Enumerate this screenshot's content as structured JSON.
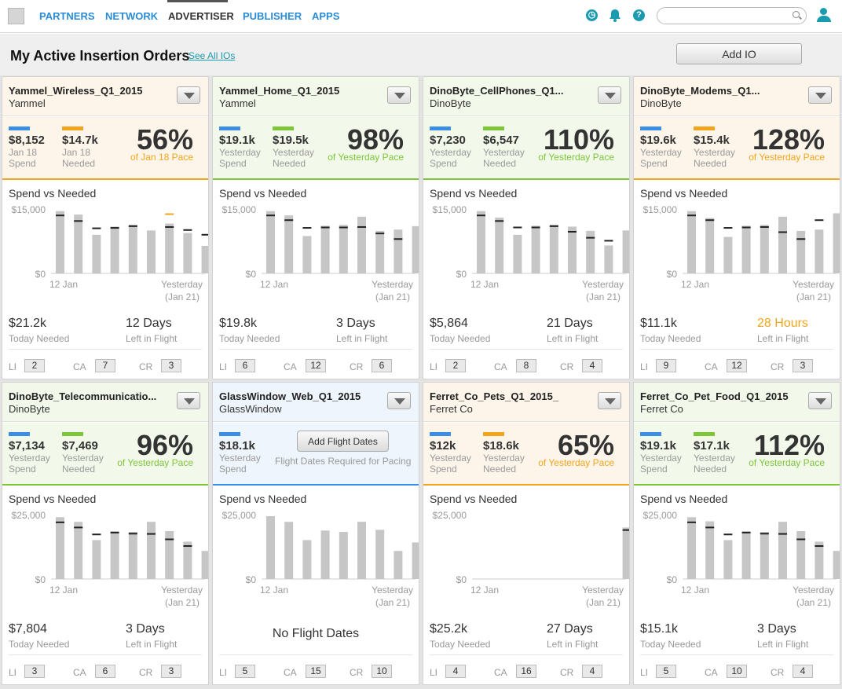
{
  "nav": {
    "items": [
      "PARTNERS",
      "NETWORK",
      "ADVERTISER",
      "PUBLISHER",
      "APPS"
    ],
    "active": "ADVERTISER",
    "search_placeholder": ""
  },
  "page": {
    "title": "My Active Insertion Orders",
    "see_all": "See All IOs",
    "add_io": "Add IO"
  },
  "colors": {
    "blue": "#3a8ee6",
    "orange": "#f2a51b",
    "green": "#7dc63a",
    "bar": "#c6c6c6",
    "needed_mark": "#222",
    "teal": "#1a9bb0"
  },
  "cards": [
    {
      "name": "Yammel_Wireless_Q1_2015",
      "advertiser": "Yammel",
      "theme": "orange",
      "spend": "$8,152",
      "spend_label1": "Jan 18",
      "spend_label2": "Spend",
      "needed": "$14.7k",
      "needed_label1": "Jan 18",
      "needed_label2": "Needed",
      "pct": "56%",
      "pct_label": "of Jan 18 Pace",
      "pct_color": "orange",
      "chart_title": "Spend vs Needed",
      "ymax_label": "$15,000",
      "ymin_label": "$0",
      "x_start": "12 Jan",
      "x_end1": "Yesterday",
      "x_end2": "(Jan 21)",
      "today_needed": "$21.2k",
      "today_needed_label": "Today Needed",
      "left": "12 Days",
      "left_label": "Left in Flight",
      "left_color": "normal",
      "li": "2",
      "ca": "7",
      "cr": "3",
      "highlight_index": 6,
      "ymax": 15000,
      "bars": [
        14500,
        13700,
        9000,
        10900,
        11300,
        10000,
        11600,
        9400,
        6400,
        8500
      ],
      "needed_marks": [
        13500,
        12200,
        10500,
        10600,
        11000,
        13800,
        10800,
        10100,
        9000,
        null
      ],
      "needed_colors": [
        null,
        null,
        null,
        null,
        null,
        "orange",
        null,
        null,
        null,
        null
      ],
      "mark_index_override": null
    },
    {
      "name": "Yammel_Home_Q1_2015",
      "advertiser": "Yammel",
      "theme": "green",
      "spend": "$19.1k",
      "spend_label1": "Yesterday",
      "spend_label2": "Spend",
      "needed": "$19.5k",
      "needed_label1": "Yesterday",
      "needed_label2": "Needed",
      "pct": "98%",
      "pct_label": "of Yesterday Pace",
      "pct_color": "green",
      "chart_title": "Spend vs Needed",
      "ymax_label": "$15,000",
      "ymin_label": "$0",
      "x_start": "12 Jan",
      "x_end1": "Yesterday",
      "x_end2": "(Jan 21)",
      "today_needed": "$19.8k",
      "today_needed_label": "Today Needed",
      "left": "3 Days",
      "left_label": "Left in Flight",
      "left_color": "normal",
      "li": "6",
      "ca": "12",
      "cr": "6",
      "highlight_index": 10,
      "ymax": 15000,
      "bars": [
        14500,
        13500,
        8700,
        11100,
        11300,
        13200,
        9900,
        10200,
        11000,
        10800
      ],
      "needed_marks": [
        13500,
        12400,
        10600,
        10700,
        10700,
        10800,
        9300,
        8000,
        11000,
        null
      ],
      "needed_colors": [
        null,
        null,
        null,
        null,
        null,
        null,
        null,
        null,
        "green",
        null
      ]
    },
    {
      "name": "DinoByte_CellPhones_Q1...",
      "advertiser": "DinoByte",
      "theme": "green",
      "spend": "$7,230",
      "spend_label1": "Yesterday",
      "spend_label2": "Spend",
      "needed": "$6,547",
      "needed_label1": "Yesterday",
      "needed_label2": "Needed",
      "pct": "110%",
      "pct_label": "of Yesterday Pace",
      "pct_color": "green",
      "chart_title": "Spend vs Needed",
      "ymax_label": "$15,000",
      "ymin_label": "$0",
      "x_start": "12 Jan",
      "x_end1": "Yesterday",
      "x_end2": "(Jan 21)",
      "today_needed": "$5,864",
      "today_needed_label": "Today Needed",
      "left": "21 Days",
      "left_label": "Left in Flight",
      "left_color": "normal",
      "li": "2",
      "ca": "8",
      "cr": "4",
      "highlight_index": 10,
      "ymax": 15000,
      "bars": [
        14500,
        13000,
        9000,
        11100,
        11300,
        10900,
        9900,
        6500,
        10000,
        9800
      ],
      "needed_marks": [
        13500,
        12200,
        10700,
        10700,
        11000,
        9700,
        8300,
        7600,
        10000,
        null
      ],
      "needed_colors": [
        null,
        null,
        null,
        null,
        null,
        null,
        null,
        null,
        "green",
        null
      ]
    },
    {
      "name": "DinoByte_Modems_Q1...",
      "advertiser": "DinoByte",
      "theme": "orange",
      "spend": "$19.6k",
      "spend_label1": "Yesterday",
      "spend_label2": "Spend",
      "needed": "$15.4k",
      "needed_label1": "Yesterday",
      "needed_label2": "Needed",
      "pct": "128%",
      "pct_label": "of Yesterday Pace",
      "pct_color": "orange",
      "chart_title": "Spend vs Needed",
      "ymax_label": "$15,000",
      "ymin_label": "$0",
      "x_start": "12 Jan",
      "x_end1": "Yesterday",
      "x_end2": "(Jan 21)",
      "today_needed": "$11.1k",
      "today_needed_label": "Today Needed",
      "left": "28 Hours",
      "left_label": "Left in Flight",
      "left_color": "orange",
      "li": "9",
      "ca": "12",
      "cr": "3",
      "highlight_index": 10,
      "ymax": 15000,
      "bars": [
        14500,
        12900,
        8500,
        11100,
        11300,
        13200,
        9900,
        10200,
        14000,
        10800
      ],
      "needed_marks": [
        13500,
        12400,
        10600,
        10700,
        10800,
        9600,
        8000,
        12400,
        11800,
        null
      ],
      "needed_colors": [
        null,
        null,
        null,
        null,
        null,
        null,
        null,
        null,
        "orange",
        null
      ]
    },
    {
      "name": "DinoByte_Telecommunicatio...",
      "advertiser": "DinoByte",
      "theme": "green",
      "spend": "$7,134",
      "spend_label1": "Yesterday",
      "spend_label2": "Spend",
      "needed": "$7,469",
      "needed_label1": "Yesterday",
      "needed_label2": "Needed",
      "pct": "96%",
      "pct_label": "of Yesterday Pace",
      "pct_color": "green",
      "chart_title": "Spend vs Needed",
      "ymax_label": "$25,000",
      "ymin_label": "$0",
      "x_start": "12 Jan",
      "x_end1": "Yesterday",
      "x_end2": "(Jan 21)",
      "today_needed": "$7,804",
      "today_needed_label": "Today Needed",
      "left": "3 Days",
      "left_label": "Left in Flight",
      "left_color": "normal",
      "li": "3",
      "ca": "6",
      "cr": "3",
      "highlight_index": 10,
      "ymax": 25000,
      "bars": [
        24000,
        22200,
        15100,
        18600,
        18300,
        22200,
        18600,
        14500,
        10900,
        14500
      ],
      "needed_marks": [
        22000,
        20000,
        17300,
        18000,
        17600,
        17500,
        15400,
        12800,
        15000,
        null
      ],
      "needed_colors": [
        null,
        null,
        null,
        null,
        null,
        null,
        null,
        null,
        "green",
        null
      ]
    },
    {
      "name": "GlassWindow_Web_Q1_2015",
      "advertiser": "GlassWindow",
      "theme": "blue",
      "spend": "$18.1k",
      "spend_label1": "Yesterday",
      "spend_label2": "Spend",
      "flight_btn": "Add Flight Dates",
      "flight_note": "Flight Dates Required for Pacing",
      "chart_title": "Spend vs Needed",
      "ymax_label": "$25,000",
      "ymin_label": "$0",
      "x_start": "12 Jan",
      "x_end1": "Yesterday",
      "x_end2": "(Jan 21)",
      "no_flight": "No Flight Dates",
      "li": "5",
      "ca": "15",
      "cr": "10",
      "highlight_index": 10,
      "ymax": 25000,
      "bars": [
        24400,
        22200,
        15100,
        18800,
        18300,
        22200,
        19100,
        10900,
        14200,
        14200
      ],
      "needed_marks": [
        null,
        null,
        null,
        null,
        null,
        null,
        null,
        null,
        null,
        null
      ],
      "needed_colors": []
    },
    {
      "name": "Ferret_Co_Pets_Q1_2015_",
      "advertiser": "Ferret Co",
      "theme": "orange",
      "spend": "$12k",
      "spend_label1": "Yesterday",
      "spend_label2": "Spend",
      "needed": "$18.6k",
      "needed_label1": "Yesterday",
      "needed_label2": "Needed",
      "pct": "65%",
      "pct_label": "of Yesterday Pace",
      "pct_color": "orange",
      "chart_title": "Spend vs Needed",
      "ymax_label": "$25,000",
      "ymin_label": "$0",
      "x_start": "12 Jan",
      "x_end1": "Yesterday",
      "x_end2": "(Jan 21)",
      "today_needed": "$25.2k",
      "today_needed_label": "Today Needed",
      "left": "27 Days",
      "left_label": "Left in Flight",
      "left_color": "normal",
      "li": "4",
      "ca": "16",
      "cr": "4",
      "highlight_index": 10,
      "ymax": 25000,
      "bars": [
        0,
        0,
        0,
        0,
        0,
        0,
        0,
        0,
        20000,
        10900
      ],
      "needed_marks": [
        null,
        null,
        null,
        null,
        null,
        null,
        null,
        null,
        null,
        null
      ],
      "needed_colors": []
    },
    {
      "name": "Ferret_Co_Pet_Food_Q1_2015",
      "advertiser": "Ferret Co",
      "theme": "green",
      "spend": "$19.1k",
      "spend_label1": "Yesterday",
      "spend_label2": "Spend",
      "needed": "$17.1k",
      "needed_label1": "Yesterday",
      "needed_label2": "Needed",
      "pct": "112%",
      "pct_label": "of Yesterday Pace",
      "pct_color": "green",
      "chart_title": "Spend vs Needed",
      "ymax_label": "$25,000",
      "ymin_label": "$0",
      "x_start": "12 Jan",
      "x_end1": "Yesterday",
      "x_end2": "(Jan 21)",
      "today_needed": "$15.1k",
      "today_needed_label": "Today Needed",
      "left": "3 Days",
      "left_label": "Left in Flight",
      "left_color": "normal",
      "li": "5",
      "ca": "10",
      "cr": "4",
      "highlight_index": 10,
      "ymax": 25000,
      "bars": [
        24000,
        22400,
        15100,
        18600,
        18300,
        22200,
        18600,
        14500,
        10900,
        14500
      ],
      "needed_marks": [
        22000,
        20000,
        17300,
        18000,
        17600,
        17500,
        15400,
        12800,
        15000,
        null
      ],
      "needed_colors": [
        null,
        null,
        null,
        null,
        null,
        null,
        null,
        null,
        "green",
        null
      ]
    }
  ],
  "footer_labels": {
    "li": "LI",
    "ca": "CA",
    "cr": "CR"
  },
  "chart_data": [
    {
      "type": "bar",
      "title": "Spend vs Needed",
      "categories": [
        "12 Jan",
        "",
        "",
        "",
        "",
        "",
        "",
        "",
        "",
        "Yesterday (Jan 21)"
      ],
      "series": [
        {
          "values": [
            14500,
            13700,
            9000,
            10900,
            11300,
            10000,
            11600,
            9400,
            6400,
            8500
          ]
        }
      ],
      "ylim": [
        0,
        15000
      ]
    },
    {
      "type": "bar",
      "title": "Spend vs Needed",
      "categories": [
        "12 Jan",
        "",
        "",
        "",
        "",
        "",
        "",
        "",
        "",
        "Yesterday (Jan 21)"
      ],
      "series": [
        {
          "values": [
            14500,
            13500,
            8700,
            11100,
            11300,
            13200,
            9900,
            10200,
            11000,
            10800
          ]
        }
      ],
      "ylim": [
        0,
        15000
      ]
    },
    {
      "type": "bar",
      "title": "Spend vs Needed",
      "categories": [
        "12 Jan",
        "",
        "",
        "",
        "",
        "",
        "",
        "",
        "",
        "Yesterday (Jan 21)"
      ],
      "series": [
        {
          "values": [
            14500,
            13000,
            9000,
            11100,
            11300,
            10900,
            9900,
            6500,
            10000,
            9800
          ]
        }
      ],
      "ylim": [
        0,
        15000
      ]
    },
    {
      "type": "bar",
      "title": "Spend vs Needed",
      "categories": [
        "12 Jan",
        "",
        "",
        "",
        "",
        "",
        "",
        "",
        "",
        "Yesterday (Jan 21)"
      ],
      "series": [
        {
          "values": [
            14500,
            12900,
            8500,
            11100,
            11300,
            13200,
            9900,
            10200,
            14000,
            10800
          ]
        }
      ],
      "ylim": [
        0,
        15000
      ]
    },
    {
      "type": "bar",
      "title": "Spend vs Needed",
      "categories": [
        "12 Jan",
        "",
        "",
        "",
        "",
        "",
        "",
        "",
        "",
        "Yesterday (Jan 21)"
      ],
      "series": [
        {
          "values": [
            24000,
            22200,
            15100,
            18600,
            18300,
            22200,
            18600,
            14500,
            10900,
            14500
          ]
        }
      ],
      "ylim": [
        0,
        25000
      ]
    },
    {
      "type": "bar",
      "title": "Spend vs Needed",
      "categories": [
        "12 Jan",
        "",
        "",
        "",
        "",
        "",
        "",
        "",
        "",
        "Yesterday (Jan 21)"
      ],
      "series": [
        {
          "values": [
            24400,
            22200,
            15100,
            18800,
            18300,
            22200,
            19100,
            10900,
            14200,
            14200
          ]
        }
      ],
      "ylim": [
        0,
        25000
      ]
    },
    {
      "type": "bar",
      "title": "Spend vs Needed",
      "categories": [
        "12 Jan",
        "",
        "",
        "",
        "",
        "",
        "",
        "",
        "",
        "Yesterday (Jan 21)"
      ],
      "series": [
        {
          "values": [
            0,
            0,
            0,
            0,
            0,
            0,
            0,
            0,
            20000,
            10900
          ]
        }
      ],
      "ylim": [
        0,
        25000
      ]
    },
    {
      "type": "bar",
      "title": "Spend vs Needed",
      "categories": [
        "12 Jan",
        "",
        "",
        "",
        "",
        "",
        "",
        "",
        "",
        "Yesterday (Jan 21)"
      ],
      "series": [
        {
          "values": [
            24000,
            22400,
            15100,
            18600,
            18300,
            22200,
            18600,
            14500,
            10900,
            14500
          ]
        }
      ],
      "ylim": [
        0,
        25000
      ]
    }
  ]
}
